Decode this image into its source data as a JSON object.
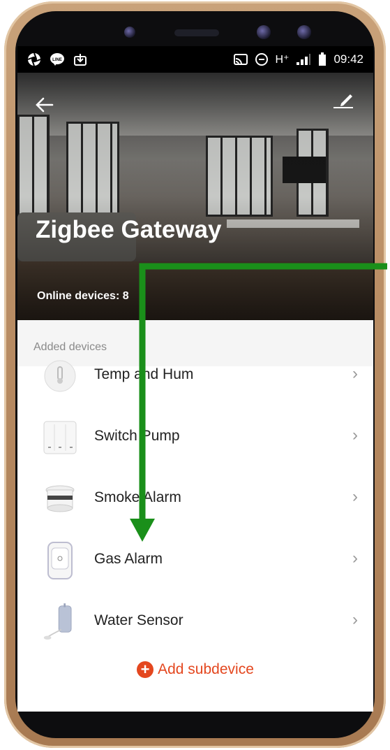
{
  "status_bar": {
    "icons_left": [
      "camera-aperture-icon",
      "line-app-icon",
      "download-icon"
    ],
    "network": "H⁺",
    "time": "09:42"
  },
  "header": {
    "title": "Zigbee Gateway",
    "online_label": "Online devices: 8"
  },
  "section": {
    "title": "Added devices"
  },
  "devices": [
    {
      "label": "Temp and Hum",
      "icon": "temp-humidity-sensor-icon"
    },
    {
      "label": "Switch Pump",
      "icon": "wall-switch-icon"
    },
    {
      "label": "Smoke Alarm",
      "icon": "smoke-detector-icon"
    },
    {
      "label": "Gas Alarm",
      "icon": "gas-detector-icon"
    },
    {
      "label": "Water Sensor",
      "icon": "water-leak-sensor-icon"
    }
  ],
  "add_button": {
    "label": "Add subdevice"
  },
  "colors": {
    "accent": "#e4471f",
    "annotation_arrow": "#1a8f1a"
  }
}
